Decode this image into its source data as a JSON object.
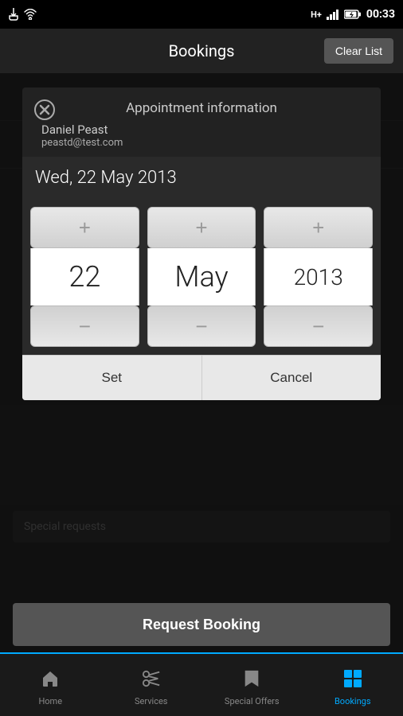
{
  "statusBar": {
    "time": "00:33",
    "icons": [
      "usb",
      "wifi",
      "hplus",
      "signal",
      "battery"
    ]
  },
  "header": {
    "title": "Bookings",
    "clearListLabel": "Clear List"
  },
  "modal": {
    "closeIcon": "✕",
    "titleLabel": "Appointment information",
    "userName": "Daniel Peast",
    "userEmail": "peastd@test.com",
    "dateDisplay": "Wed, 22 May 2013",
    "dayValue": "22",
    "monthValue": "May",
    "yearValue": "2013",
    "incrementIcon": "+",
    "decrementIcon": "−",
    "setLabel": "Set",
    "cancelLabel": "Cancel"
  },
  "background": {
    "specialRequestsPlaceholder": "Special requests"
  },
  "requestBooking": {
    "label": "Request Booking"
  },
  "bottomNav": {
    "items": [
      {
        "id": "home",
        "label": "Home",
        "icon": "house",
        "active": false
      },
      {
        "id": "services",
        "label": "Services",
        "icon": "scissors",
        "active": false
      },
      {
        "id": "special-offers",
        "label": "Special Offers",
        "icon": "bookmark",
        "active": false
      },
      {
        "id": "bookings",
        "label": "Bookings",
        "icon": "grid",
        "active": true
      }
    ]
  }
}
